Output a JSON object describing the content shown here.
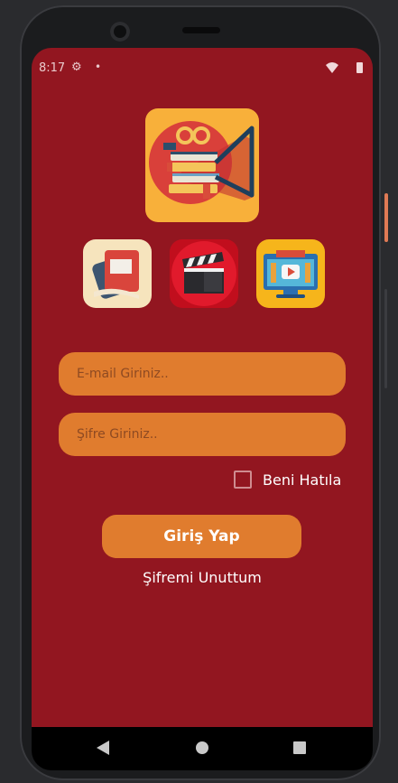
{
  "status_bar": {
    "time": "8:17",
    "gear_icon": "gear-icon",
    "wifi_icon": "wifi-icon",
    "battery_icon": "battery-icon"
  },
  "logo": {
    "icon": "books-projector-logo-icon"
  },
  "category_icons": [
    {
      "icon": "book-icon"
    },
    {
      "icon": "clapperboard-icon"
    },
    {
      "icon": "tv-video-icon"
    }
  ],
  "form": {
    "email_placeholder": "E-mail Giriniz..",
    "email_value": "",
    "password_placeholder": "Şifre Giriniz..",
    "password_value": "",
    "remember_label": "Beni Hatıla",
    "remember_checked": false,
    "login_label": "Giriş Yap",
    "forgot_label": "Şifremi Unuttum"
  },
  "colors": {
    "background": "#921620",
    "accent": "#e07c2e",
    "logo_bg": "#f8b03a"
  },
  "nav": {
    "back_icon": "back-icon",
    "home_icon": "home-icon",
    "recent_icon": "recent-apps-icon"
  }
}
